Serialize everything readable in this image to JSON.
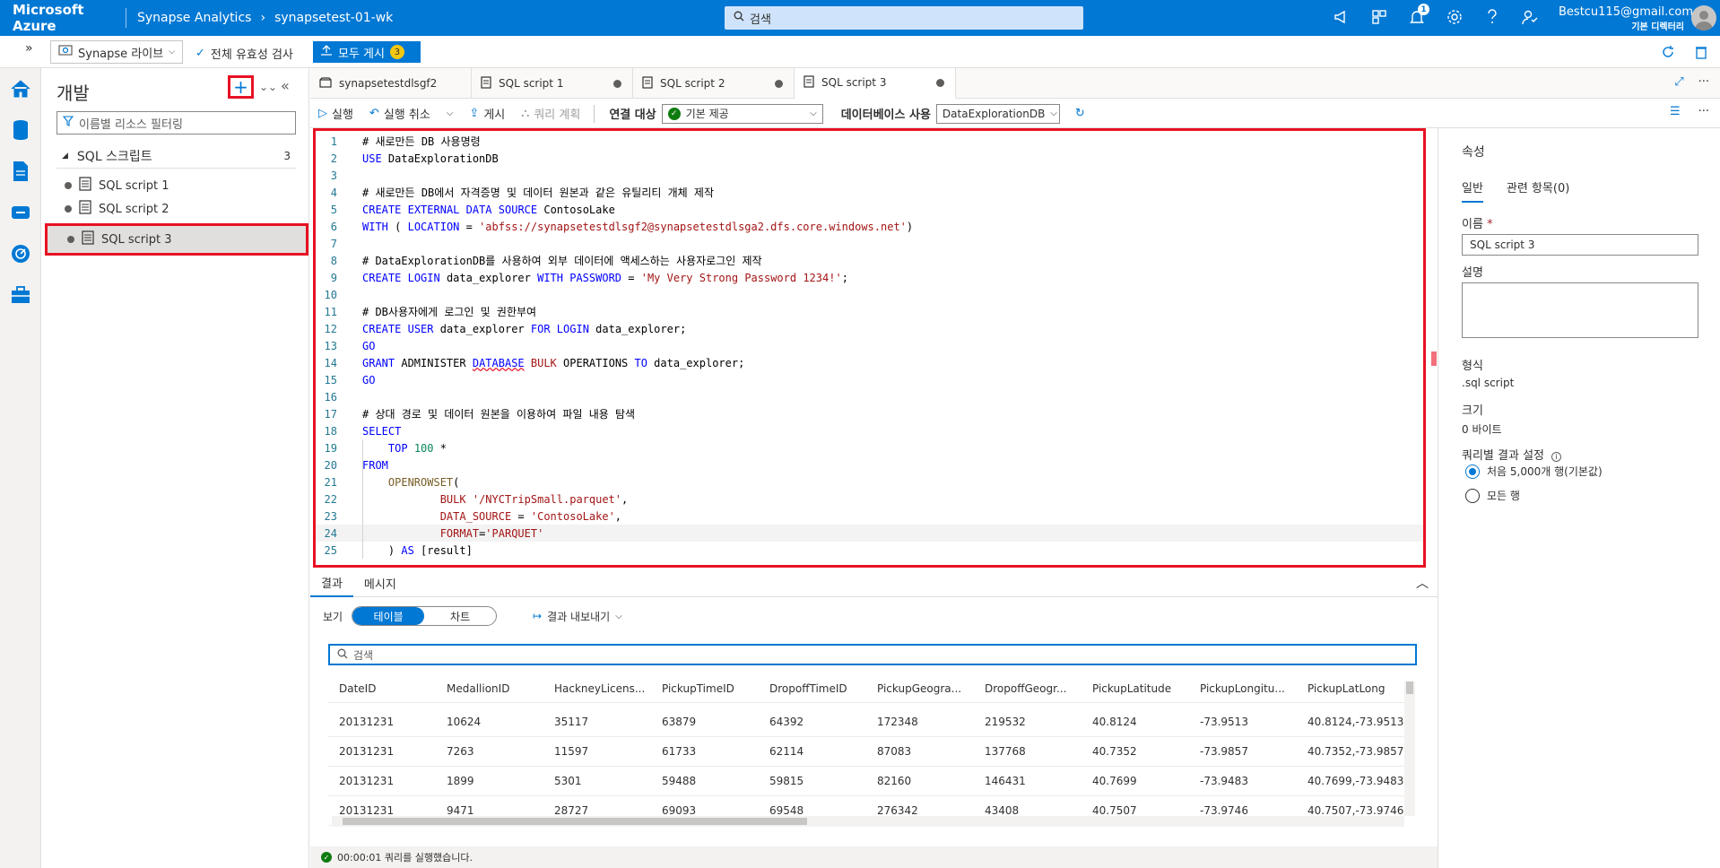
{
  "topbar": {
    "brand": "Microsoft Azure",
    "service": "Synapse Analytics",
    "workspace": "synapsetest-01-wk",
    "search_placeholder": "검색",
    "notification_count": "1",
    "user_email": "Bestcu115@gmail.com",
    "user_role": "기본 디렉터리"
  },
  "toolbar2": {
    "live_label": "Synapse 라이브",
    "validate_label": "전체 유효성 검사",
    "publish_label": "모두 게시",
    "publish_count": "3"
  },
  "develop": {
    "title": "개발",
    "filter_placeholder": "이름별 리소스 필터링",
    "group_label": "SQL 스크립트",
    "group_count": "3",
    "items": [
      "SQL script 1",
      "SQL script 2",
      "SQL script 3"
    ]
  },
  "tabs": [
    {
      "label": "synapsetestdlsgf2",
      "modified": false
    },
    {
      "label": "SQL script 1",
      "modified": true
    },
    {
      "label": "SQL script 2",
      "modified": true
    },
    {
      "label": "SQL script 3",
      "modified": true,
      "active": true
    }
  ],
  "editor_toolbar": {
    "run": "실행",
    "undo": "실행 취소",
    "publish": "게시",
    "query_plan": "쿼리 계획",
    "connect_label": "연결 대상",
    "connect_value": "기본 제공",
    "db_label": "데이터베이스 사용",
    "db_value": "DataExplorationDB"
  },
  "code_lines": [
    "# 새로만든 DB 사용명령",
    "USE DataExplorationDB",
    "",
    "# 새로만든 DB에서 자격증명 및 데이터 원본과 같은 유틸리티 개체 제작",
    "CREATE EXTERNAL DATA SOURCE ContosoLake",
    "WITH ( LOCATION = 'abfss://synapsetestdlsgf2@synapsetestdlsga2.dfs.core.windows.net')",
    "",
    "# DataExplorationDB를 사용하여 외부 데이터에 액세스하는 사용자로그인 제작",
    "CREATE LOGIN data_explorer WITH PASSWORD = 'My Very Strong Password 1234!';",
    "",
    "# DB사용자에게 로그인 및 권한부여",
    "CREATE USER data_explorer FOR LOGIN data_explorer;",
    "GO",
    "GRANT ADMINISTER DATABASE BULK OPERATIONS TO data_explorer;",
    "GO",
    "",
    "# 상대 경로 및 데이터 원본을 이용하여 파일 내용 탐색",
    "SELECT",
    "    TOP 100 *",
    "FROM",
    "    OPENROWSET(",
    "            BULK '/NYCTripSmall.parquet',",
    "            DATA_SOURCE = 'ContosoLake',",
    "            FORMAT='PARQUET'",
    "    ) AS [result]"
  ],
  "results": {
    "tab_results": "결과",
    "tab_messages": "메시지",
    "view_label": "보기",
    "view_table": "테이블",
    "view_chart": "차트",
    "export_label": "결과 내보내기",
    "search_placeholder": "검색",
    "columns": [
      "DateID",
      "MedallionID",
      "HackneyLicens...",
      "PickupTimeID",
      "DropoffTimeID",
      "PickupGeogra...",
      "DropoffGeogr...",
      "PickupLatitude",
      "PickupLongitu...",
      "PickupLatLong"
    ],
    "rows": [
      [
        "20131231",
        "10624",
        "35117",
        "63879",
        "64392",
        "172348",
        "219532",
        "40.8124",
        "-73.9513",
        "40.8124,-73.9513"
      ],
      [
        "20131231",
        "7263",
        "11597",
        "61733",
        "62114",
        "87083",
        "137768",
        "40.7352",
        "-73.9857",
        "40.7352,-73.9857"
      ],
      [
        "20131231",
        "1899",
        "5301",
        "59488",
        "59815",
        "82160",
        "146431",
        "40.7699",
        "-73.9483",
        "40.7699,-73.9483"
      ],
      [
        "20131231",
        "9471",
        "28727",
        "69093",
        "69548",
        "276342",
        "43408",
        "40.7507",
        "-73.9746",
        "40.7507,-73.9746"
      ]
    ],
    "status": "00:00:01 쿼리를 실행했습니다."
  },
  "properties": {
    "title": "속성",
    "tab_general": "일반",
    "tab_related": "관련 항목(0)",
    "name_label": "이름",
    "name_required": "*",
    "name_value": "SQL script 3",
    "desc_label": "설명",
    "format_label": "형식",
    "format_value": ".sql script",
    "size_label": "크기",
    "size_value": "0 바이트",
    "result_setting_label": "쿼리별 결과 설정",
    "option_first": "처음 5,000개 행(기본값)",
    "option_all": "모든 행"
  }
}
